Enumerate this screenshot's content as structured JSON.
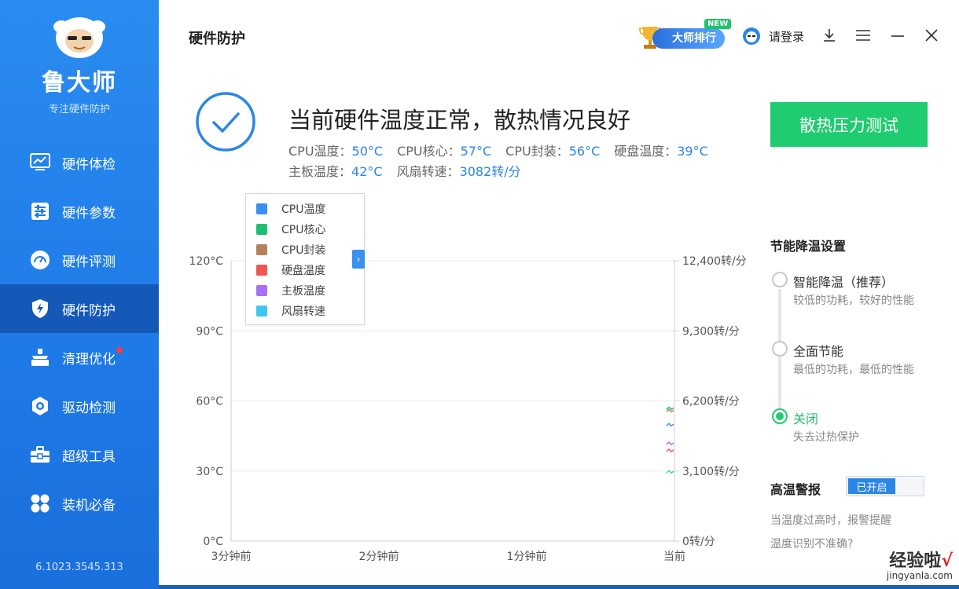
{
  "app": {
    "name": "鲁大师",
    "tagline": "专注硬件防护",
    "version": "6.1023.3545.313"
  },
  "sidebar": {
    "items": [
      {
        "label": "硬件体检",
        "icon": "monitor-chart-icon",
        "active": false
      },
      {
        "label": "硬件参数",
        "icon": "sliders-icon",
        "active": false
      },
      {
        "label": "硬件评测",
        "icon": "gauge-icon",
        "active": false
      },
      {
        "label": "硬件防护",
        "icon": "shield-bolt-icon",
        "active": true
      },
      {
        "label": "清理优化",
        "icon": "broom-icon",
        "active": false,
        "dot": true
      },
      {
        "label": "驱动检测",
        "icon": "gear-icon",
        "active": false
      },
      {
        "label": "超级工具",
        "icon": "toolbox-icon",
        "active": false
      },
      {
        "label": "装机必备",
        "icon": "apps-grid-icon",
        "active": false
      }
    ]
  },
  "header": {
    "title": "硬件防护",
    "rank_label": "大师排行",
    "new_tag": "NEW",
    "login_label": "请登录"
  },
  "status": {
    "headline": "当前硬件温度正常，散热情况良好",
    "readings": [
      {
        "label": "CPU温度：",
        "value": "50°C"
      },
      {
        "label": "CPU核心：",
        "value": "57°C"
      },
      {
        "label": "CPU封装：",
        "value": "56°C"
      },
      {
        "label": "硬盘温度：",
        "value": "39°C"
      },
      {
        "label": "主板温度：",
        "value": "42°C"
      },
      {
        "label": "风扇转速：",
        "value": "3082转/分"
      }
    ],
    "stress_test_label": "散热压力测试"
  },
  "chart_data": {
    "type": "line",
    "title": "",
    "x_tick_labels": [
      "3分钟前",
      "2分钟前",
      "1分钟前",
      "当前"
    ],
    "y_left_ticks": [
      "0°C",
      "30°C",
      "60°C",
      "90°C",
      "120°C"
    ],
    "y_right_ticks": [
      "0转/分",
      "3,100转/分",
      "6,200转/分",
      "9,300转/分",
      "12,400转/分"
    ],
    "y_left_range": [
      0,
      120
    ],
    "y_right_range": [
      0,
      12400
    ],
    "grid": true,
    "legend_position": "top-left",
    "series": [
      {
        "name": "CPU温度",
        "color": "#3a8ff0",
        "axis": "left",
        "values": [
          50
        ]
      },
      {
        "name": "CPU核心",
        "color": "#1fbf73",
        "axis": "left",
        "values": [
          57
        ]
      },
      {
        "name": "CPU封装",
        "color": "#b5835a",
        "axis": "left",
        "values": [
          56
        ]
      },
      {
        "name": "硬盘温度",
        "color": "#f25555",
        "axis": "left",
        "values": [
          39
        ]
      },
      {
        "name": "主板温度",
        "color": "#a86ef5",
        "axis": "left",
        "values": [
          42
        ]
      },
      {
        "name": "风扇转速",
        "color": "#3fc8ef",
        "axis": "right",
        "values": [
          3082
        ]
      }
    ]
  },
  "power": {
    "title": "节能降温设置",
    "options": [
      {
        "label": "智能降温（推荐）",
        "desc": "较低的功耗，较好的性能",
        "selected": false
      },
      {
        "label": "全面节能",
        "desc": "最低的功耗，最低的性能",
        "selected": false
      },
      {
        "label": "关闭",
        "desc": "失去过热保护",
        "selected": true
      }
    ]
  },
  "alarm": {
    "title": "高温警报",
    "toggle_label": "已开启",
    "enabled": true,
    "desc": "当温度过高时，报警提醒",
    "inaccurate_link": "温度识别不准确?"
  },
  "watermark": {
    "text": "经验啦",
    "check": "√",
    "url": "jingyanla.com"
  },
  "colors": {
    "accent_blue": "#2b86e6",
    "accent_green": "#1fcc6f",
    "sidebar_active": "#1559b8"
  }
}
